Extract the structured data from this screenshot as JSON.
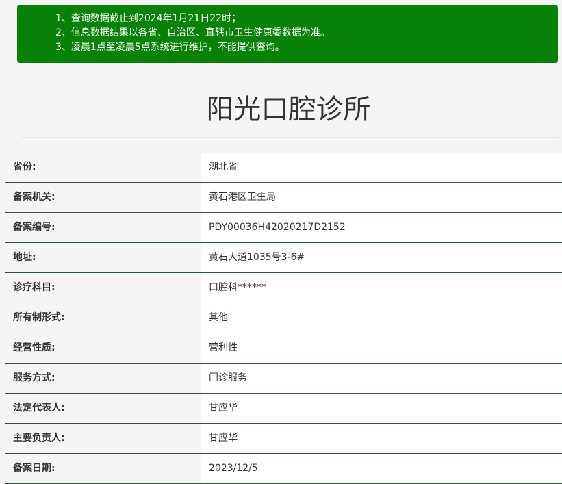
{
  "notice": {
    "lines": [
      "1、查询数据截止到2024年1月21日22时；",
      "2、信息数据结果以各省、自治区、直辖市卫生健康委数据为准。",
      "3、凌晨1点至凌晨5点系统进行维护，不能提供查询。"
    ]
  },
  "page": {
    "title": "阳光口腔诊所"
  },
  "colors": {
    "notice_bg": "#078207",
    "row_divider": "#1f5a3d",
    "label_bg": "#f5f5f5",
    "value_bg": "#ffffff"
  },
  "info": {
    "rows": [
      {
        "label": "省份:",
        "value": "湖北省"
      },
      {
        "label": "备案机关:",
        "value": "黄石港区卫生局"
      },
      {
        "label": "备案编号:",
        "value": "PDY00036H42020217D2152"
      },
      {
        "label": "地址:",
        "value": "黄石大道1035号3-6#"
      },
      {
        "label": "诊疗科目:",
        "value": "口腔科******"
      },
      {
        "label": "所有制形式:",
        "value": "其他"
      },
      {
        "label": "经营性质:",
        "value": "营利性"
      },
      {
        "label": "服务方式:",
        "value": "门诊服务"
      },
      {
        "label": "法定代表人:",
        "value": "甘应华"
      },
      {
        "label": "主要负责人:",
        "value": "甘应华"
      },
      {
        "label": "备案日期:",
        "value": "2023/12/5"
      }
    ]
  }
}
